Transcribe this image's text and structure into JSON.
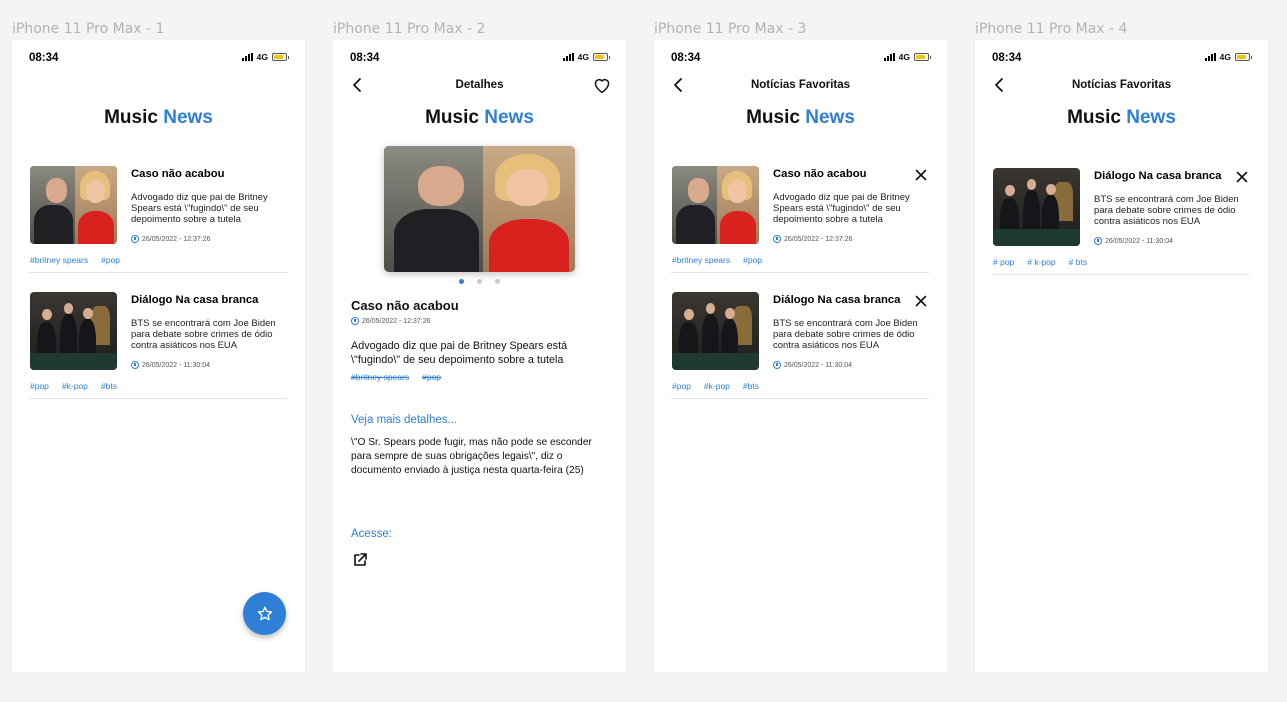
{
  "frames": [
    {
      "label": "iPhone 11 Pro Max - 1"
    },
    {
      "label": "iPhone 11 Pro Max - 2"
    },
    {
      "label": "iPhone 11 Pro Max - 3"
    },
    {
      "label": "iPhone 11 Pro Max - 4"
    }
  ],
  "status": {
    "time": "08:34",
    "network": "4G"
  },
  "brand": {
    "part1": "Music",
    "part2": "News"
  },
  "colors": {
    "accent": "#2f7fd6",
    "battery": "#f2c200"
  },
  "news": [
    {
      "title": "Caso não acabou",
      "desc": "Advogado diz que pai de Britney Spears está \\\"fugindo\\\" de seu depoimento sobre a tutela",
      "date": "26/05/2022 - 12:37:26",
      "tags": [
        "#britney spears",
        "#pop"
      ]
    },
    {
      "title": "Diálogo Na casa branca",
      "desc": "BTS se encontrará com Joe Biden para debate sobre crimes de ódio contra asiáticos nos EUA",
      "date": "26/05/2022 - 11:30:04",
      "tags": [
        "#pop",
        "#k-pop",
        "#bts"
      ],
      "tags_alt": [
        "# pop",
        "# k-pop",
        "# bts"
      ]
    }
  ],
  "detail": {
    "header_title": "Detalhes",
    "title": "Caso não acabou",
    "date": "26/05/2022 - 12:37:26",
    "desc": "Advogado diz que pai de Britney Spears está \\\"fugindo\\\" de seu depoimento sobre a tutela",
    "tags": [
      "#britney spears",
      "#pop"
    ],
    "more_label": "Veja mais detalhes...",
    "body": "\\\"O Sr. Spears pode fugir, mas não pode se esconder para sempre de suas obrigações legais\\\", diz o documento enviado à justiça nesta quarta-feira (25)",
    "access_label": "Acesse:"
  },
  "favorites": {
    "header_title": "Notícias Favoritas"
  },
  "icons": {
    "back": "chevron-left-icon",
    "favorite": "heart-icon",
    "remove": "close-icon",
    "fab": "star-icon",
    "date": "clock-icon",
    "external": "external-link-icon"
  }
}
